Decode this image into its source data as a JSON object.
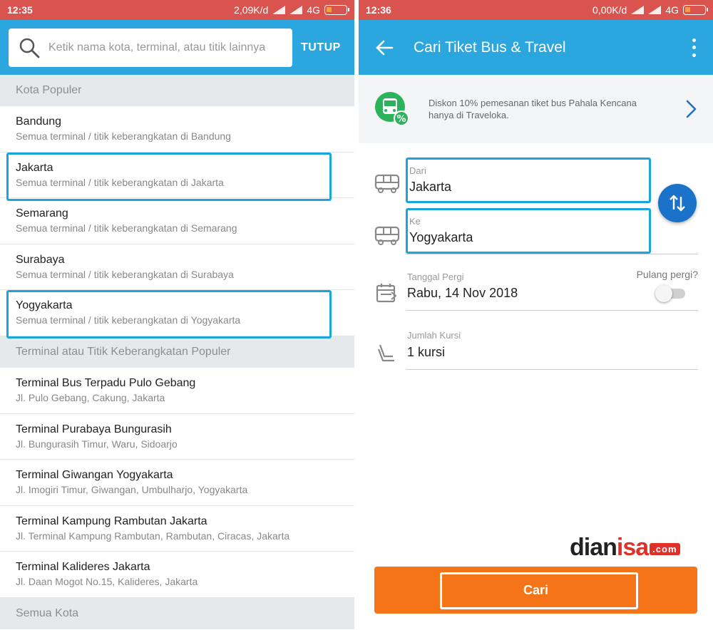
{
  "left": {
    "status": {
      "time": "12:35",
      "speed": "2,09K/d",
      "network": "4G"
    },
    "search": {
      "placeholder": "Ketik nama kota, terminal, atau titik lainnya",
      "close_label": "TUTUP"
    },
    "sections": [
      {
        "header": "Kota Populer",
        "items": [
          {
            "title": "Bandung",
            "sub": "Semua terminal / titik keberangkatan di Bandung"
          },
          {
            "title": "Jakarta",
            "sub": "Semua terminal / titik keberangkatan di Jakarta"
          },
          {
            "title": "Semarang",
            "sub": "Semua terminal / titik keberangkatan di Semarang"
          },
          {
            "title": "Surabaya",
            "sub": "Semua terminal / titik keberangkatan di Surabaya"
          },
          {
            "title": "Yogyakarta",
            "sub": "Semua terminal / titik keberangkatan di Yogyakarta"
          }
        ]
      },
      {
        "header": "Terminal atau Titik Keberangkatan Populer",
        "items": [
          {
            "title": "Terminal Bus Terpadu Pulo Gebang",
            "sub": "Jl. Pulo Gebang, Cakung, Jakarta"
          },
          {
            "title": "Terminal Purabaya Bungurasih",
            "sub": "Jl. Bungurasih Timur, Waru, Sidoarjo"
          },
          {
            "title": "Terminal Giwangan Yogyakarta",
            "sub": "Jl. Imogiri Timur, Giwangan, Umbulharjo, Yogyakarta"
          },
          {
            "title": "Terminal Kampung Rambutan Jakarta",
            "sub": "Jl. Terminal Kampung Rambutan, Rambutan, Ciracas, Jakarta"
          },
          {
            "title": "Terminal Kalideres Jakarta",
            "sub": "Jl. Daan Mogot No.15, Kalideres, Jakarta"
          }
        ]
      },
      {
        "header": "Semua Kota",
        "items": []
      }
    ]
  },
  "right": {
    "status": {
      "time": "12:36",
      "speed": "0,00K/d",
      "network": "4G"
    },
    "appbar": {
      "title": "Cari Tiket Bus & Travel"
    },
    "promo": {
      "text": "Diskon 10% pemesanan tiket bus Pahala Kencana hanya di Traveloka."
    },
    "form": {
      "from": {
        "label": "Dari",
        "value": "Jakarta"
      },
      "to": {
        "label": "Ke",
        "value": "Yogyakarta"
      },
      "date": {
        "label": "Tanggal Pergi",
        "value": "Rabu, 14 Nov 2018"
      },
      "return_label": "Pulang pergi?",
      "return_enabled": false,
      "seats": {
        "label": "Jumlah Kursi",
        "value": "1 kursi"
      }
    },
    "watermark": {
      "part1": "dian",
      "part2": "isa",
      "domain": ".com"
    },
    "search_button": {
      "label": "Cari"
    }
  },
  "colors": {
    "primary": "#2ba6de",
    "statusbar": "#d9534f",
    "accent_button": "#f57417",
    "fab": "#1a73c9",
    "highlight": "#1aa5dc",
    "promo_icon": "#2bb25a"
  }
}
